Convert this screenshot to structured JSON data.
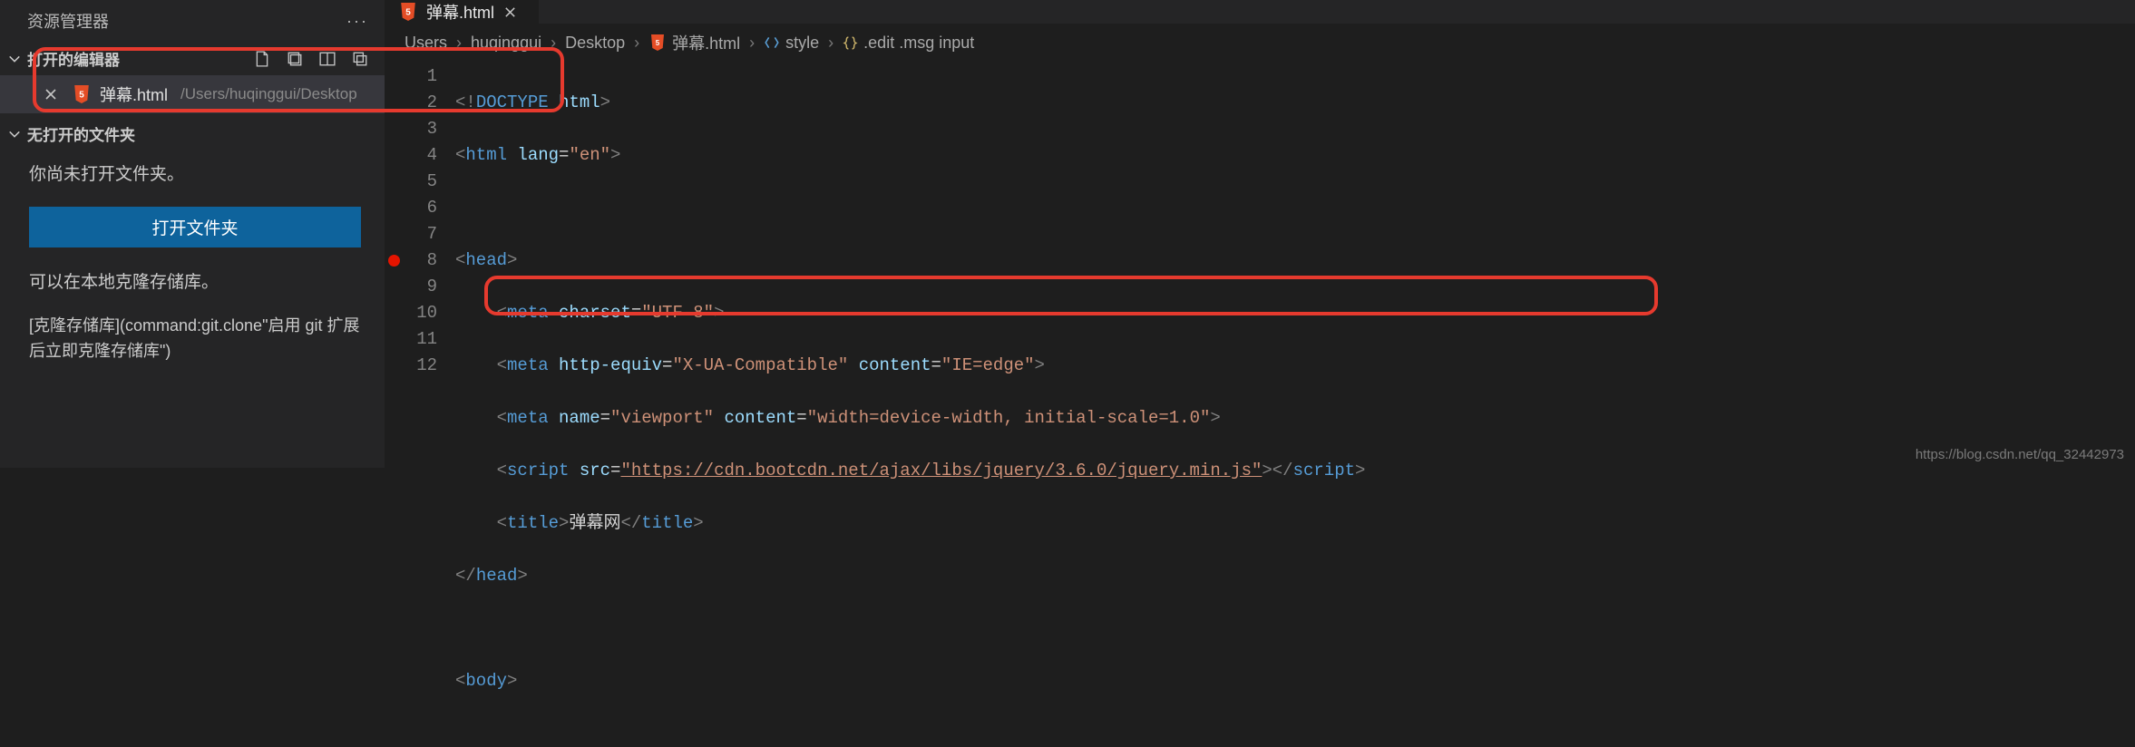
{
  "sidebar": {
    "title": "资源管理器",
    "sections": {
      "open_editors": {
        "label": "打开的编辑器",
        "file": {
          "name": "弹幕.html",
          "path": "/Users/huqinggui/Desktop"
        }
      },
      "unopened_folder": {
        "label": "无打开的文件夹"
      }
    },
    "body": {
      "no_folder_text": "你尚未打开文件夹。",
      "open_folder_button": "打开文件夹",
      "clone_hint": "可以在本地克隆存储库。",
      "clone_cmd_text": "[克隆存储库](command:git.clone\"启用 git 扩展后立即克隆存储库\")"
    }
  },
  "tab": {
    "label": "弹幕.html"
  },
  "breadcrumbs": {
    "items": [
      "Users",
      "huqinggui",
      "Desktop",
      "弹幕.html",
      "style",
      ".edit .msg input"
    ]
  },
  "code": {
    "line_numbers": [
      "1",
      "2",
      "3",
      "4",
      "5",
      "6",
      "7",
      "8",
      "9",
      "10",
      "11",
      "12"
    ],
    "breakpoint_at": 8,
    "lines": {
      "l1_doctype": "<!DOCTYPE html>",
      "l2_a": "<",
      "l2_tag": "html",
      "l2_attr": " lang",
      "l2_eq": "=",
      "l2_str": "\"en\"",
      "l2_b": ">",
      "l4_a": "<",
      "l4_tag": "head",
      "l4_b": ">",
      "l5_a": "<",
      "l5_tag": "meta",
      "l5_attr": " charset",
      "l5_eq": "=",
      "l5_str": "\"UTF-8\"",
      "l5_b": ">",
      "l6_a": "<",
      "l6_tag": "meta",
      "l6_attr1": " http-equiv",
      "l6_str1": "\"X-UA-Compatible\"",
      "l6_attr2": " content",
      "l6_str2": "\"IE=edge\"",
      "l6_b": ">",
      "l7_a": "<",
      "l7_tag": "meta",
      "l7_attr1": " name",
      "l7_str1": "\"viewport\"",
      "l7_attr2": " content",
      "l7_str2": "\"width=device-width, initial-scale=1.0\"",
      "l7_b": ">",
      "l8_a": "<",
      "l8_tag": "script",
      "l8_attr": " src",
      "l8_link": "\"https://cdn.bootcdn.net/ajax/libs/jquery/3.6.0/jquery.min.js\"",
      "l8_b": ">",
      "l8_c": "</",
      "l8_tag2": "script",
      "l8_d": ">",
      "l9_a": "<",
      "l9_tag": "title",
      "l9_b": ">",
      "l9_text": "弹幕网",
      "l9_c": "</",
      "l9_tag2": "title",
      "l9_d": ">",
      "l10_a": "</",
      "l10_tag": "head",
      "l10_b": ">",
      "l12_a": "<",
      "l12_tag": "body",
      "l12_b": ">"
    }
  },
  "watermark": "https://blog.csdn.net/qq_32442973"
}
